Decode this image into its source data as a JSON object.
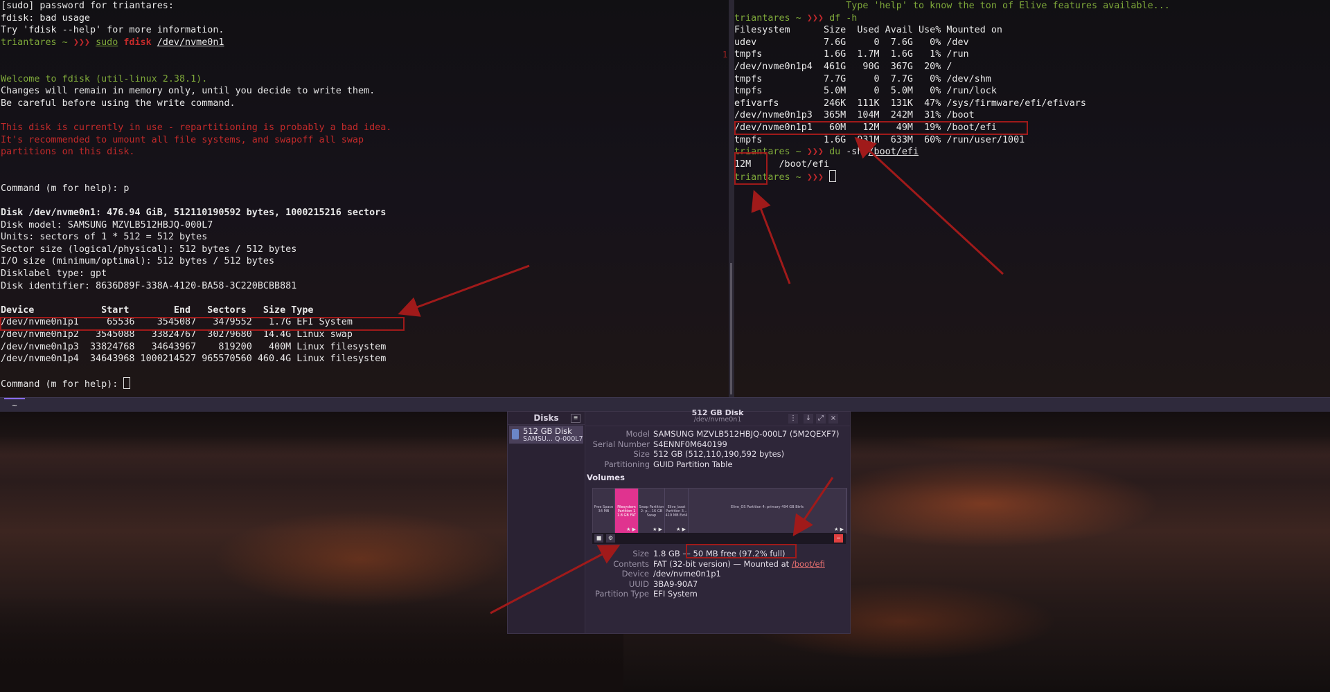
{
  "left_terminal": {
    "lines": [
      {
        "segs": [
          {
            "t": "[sudo] password for triantares:"
          }
        ]
      },
      {
        "segs": [
          {
            "t": "fdisk: bad usage"
          }
        ]
      },
      {
        "segs": [
          {
            "t": "Try 'fdisk --help' for more information."
          }
        ]
      },
      {
        "segs": [
          {
            "t": "triantares ~ ",
            "c": "green"
          },
          {
            "t": "❯❯❯ ",
            "c": "prompt-arrows"
          },
          {
            "t": "sudo",
            "c": "green ul"
          },
          {
            "t": " "
          },
          {
            "t": "fdisk",
            "c": "red bold"
          },
          {
            "t": " "
          },
          {
            "t": "/dev/nvme0n1",
            "c": "ul"
          }
        ]
      },
      {
        "segs": [
          {
            "t": ""
          }
        ]
      },
      {
        "segs": [
          {
            "t": ""
          }
        ]
      },
      {
        "segs": [
          {
            "t": "Welcome to fdisk (util-linux 2.38.1).",
            "c": "green"
          }
        ]
      },
      {
        "segs": [
          {
            "t": "Changes will remain in memory only, until you decide to write them."
          }
        ]
      },
      {
        "segs": [
          {
            "t": "Be careful before using the write command."
          }
        ]
      },
      {
        "segs": [
          {
            "t": ""
          }
        ]
      },
      {
        "segs": [
          {
            "t": "This disk is currently in use - repartitioning is probably a bad idea.",
            "c": "red"
          }
        ]
      },
      {
        "segs": [
          {
            "t": "It's recommended to umount all file systems, and swapoff all swap",
            "c": "red"
          }
        ]
      },
      {
        "segs": [
          {
            "t": "partitions on this disk.",
            "c": "red"
          }
        ]
      },
      {
        "segs": [
          {
            "t": ""
          }
        ]
      },
      {
        "segs": [
          {
            "t": ""
          }
        ]
      },
      {
        "segs": [
          {
            "t": "Command (m for help): p"
          }
        ]
      },
      {
        "segs": [
          {
            "t": ""
          }
        ]
      },
      {
        "segs": [
          {
            "t": "Disk /dev/nvme0n1: 476.94 GiB, 512110190592 bytes, 1000215216 sectors",
            "c": "bold"
          }
        ]
      },
      {
        "segs": [
          {
            "t": "Disk model: SAMSUNG MZVLB512HBJQ-000L7"
          }
        ]
      },
      {
        "segs": [
          {
            "t": "Units: sectors of 1 * 512 = 512 bytes"
          }
        ]
      },
      {
        "segs": [
          {
            "t": "Sector size (logical/physical): 512 bytes / 512 bytes"
          }
        ]
      },
      {
        "segs": [
          {
            "t": "I/O size (minimum/optimal): 512 bytes / 512 bytes"
          }
        ]
      },
      {
        "segs": [
          {
            "t": "Disklabel type: gpt"
          }
        ]
      },
      {
        "segs": [
          {
            "t": "Disk identifier: 8636D89F-338A-4120-BA58-3C220BCBB881"
          }
        ]
      },
      {
        "segs": [
          {
            "t": ""
          }
        ]
      },
      {
        "segs": [
          {
            "t": "Device            Start        End   Sectors   Size Type",
            "c": "bold"
          }
        ]
      },
      {
        "segs": [
          {
            "t": "/dev/nvme0n1p1     65536    3545087   3479552   1.7G EFI System"
          }
        ]
      },
      {
        "segs": [
          {
            "t": "/dev/nvme0n1p2   3545088   33824767  30279680  14.4G Linux swap"
          }
        ]
      },
      {
        "segs": [
          {
            "t": "/dev/nvme0n1p3  33824768   34643967    819200   400M Linux filesystem"
          }
        ]
      },
      {
        "segs": [
          {
            "t": "/dev/nvme0n1p4  34643968 1000214527 965570560 460.4G Linux filesystem"
          }
        ]
      },
      {
        "segs": [
          {
            "t": ""
          }
        ]
      },
      {
        "segs": [
          {
            "t": "Command (m for help): "
          },
          {
            "cursor": true
          }
        ]
      }
    ]
  },
  "right_terminal": {
    "lines": [
      {
        "segs": [
          {
            "t": "                    Type 'help' to know the ton of Elive features available...",
            "c": "green"
          }
        ]
      },
      {
        "segs": [
          {
            "t": "triantares ~ ",
            "c": "green"
          },
          {
            "t": "❯❯❯ ",
            "c": "prompt-arrows"
          },
          {
            "t": "df -h",
            "c": "green"
          }
        ]
      },
      {
        "segs": [
          {
            "t": "Filesystem      Size  Used Avail Use% Mounted on"
          }
        ]
      },
      {
        "segs": [
          {
            "t": "udev            7.6G     0  7.6G   0% /dev"
          }
        ]
      },
      {
        "segs": [
          {
            "t": "tmpfs           1.6G  1.7M  1.6G   1% /run"
          }
        ]
      },
      {
        "segs": [
          {
            "t": "/dev/nvme0n1p4  461G   90G  367G  20% /"
          }
        ]
      },
      {
        "segs": [
          {
            "t": "tmpfs           7.7G     0  7.7G   0% /dev/shm"
          }
        ]
      },
      {
        "segs": [
          {
            "t": "tmpfs           5.0M     0  5.0M   0% /run/lock"
          }
        ]
      },
      {
        "segs": [
          {
            "t": "efivarfs        246K  111K  131K  47% /sys/firmware/efi/efivars"
          }
        ]
      },
      {
        "segs": [
          {
            "t": "/dev/nvme0n1p3  365M  104M  242M  31% /boot"
          }
        ]
      },
      {
        "segs": [
          {
            "t": "/dev/nvme0n1p1   60M   12M   49M  19% /boot/efi"
          }
        ]
      },
      {
        "segs": [
          {
            "t": "tmpfs           1.6G  931M  633M  60% /run/user/1001"
          }
        ]
      },
      {
        "segs": [
          {
            "t": "triantares ~ ",
            "c": "green"
          },
          {
            "t": "❯❯❯ ",
            "c": "prompt-arrows"
          },
          {
            "t": "du ",
            "c": "green"
          },
          {
            "t": "-sh "
          },
          {
            "t": "/boot/efi",
            "c": "ul"
          }
        ]
      },
      {
        "segs": [
          {
            "t": "12M     /boot/efi"
          }
        ]
      },
      {
        "segs": [
          {
            "t": "triantares ~ ",
            "c": "green"
          },
          {
            "t": "❯❯❯ ",
            "c": "prompt-arrows"
          },
          {
            "cursor": true
          }
        ]
      }
    ],
    "gutter_marker": "1"
  },
  "shelf": {
    "tab_label": "~"
  },
  "disks": {
    "sidebar_title": "Disks",
    "disk_name": "512 GB Disk",
    "disk_sub": "SAMSU... Q-000L7",
    "window_title": "512 GB Disk",
    "window_subtitle": "/dev/nvme0n1",
    "info": [
      {
        "k": "Model",
        "v": "SAMSUNG MZVLB512HBJQ-000L7 (5M2QEXF7)"
      },
      {
        "k": "Serial Number",
        "v": "S4ENNF0M640199"
      },
      {
        "k": "Size",
        "v": "512 GB (512,110,190,592 bytes)"
      },
      {
        "k": "Partitioning",
        "v": "GUID Partition Table"
      }
    ],
    "volumes_title": "Volumes",
    "segments": [
      {
        "label": "Free Space 34 MB",
        "selected": false,
        "stars": ""
      },
      {
        "label": "Filesystem Partition 1 1.8 GB FAT",
        "selected": true,
        "stars": "★ ▶"
      },
      {
        "label": "Swap Partition 2: p... 16 GB Swap",
        "selected": false,
        "stars": "★ ▶"
      },
      {
        "label": "Elive_boot Partition 3... 419 MB Ext4",
        "selected": false,
        "stars": "★ ▶"
      },
      {
        "label": "Elive_OS Partition 4: primary 494 GB Btrfs",
        "selected": false,
        "stars": "★ ▶"
      }
    ],
    "details": [
      {
        "k": "Size",
        "v": "1.8 GB — 50 MB free (97.2% full)"
      },
      {
        "k": "Contents",
        "v": "FAT (32-bit version) — Mounted at ",
        "link": "/boot/efi"
      },
      {
        "k": "Device",
        "v": "/dev/nvme0n1p1"
      },
      {
        "k": "UUID",
        "v": "3BA9-90A7"
      },
      {
        "k": "Partition Type",
        "v": "EFI System"
      }
    ]
  },
  "colors": {
    "prompt_green": "#7ea83a",
    "warning_red": "#c22a2a",
    "annotation_red": "#a01a1a",
    "partition_pink": "#e0338f"
  }
}
